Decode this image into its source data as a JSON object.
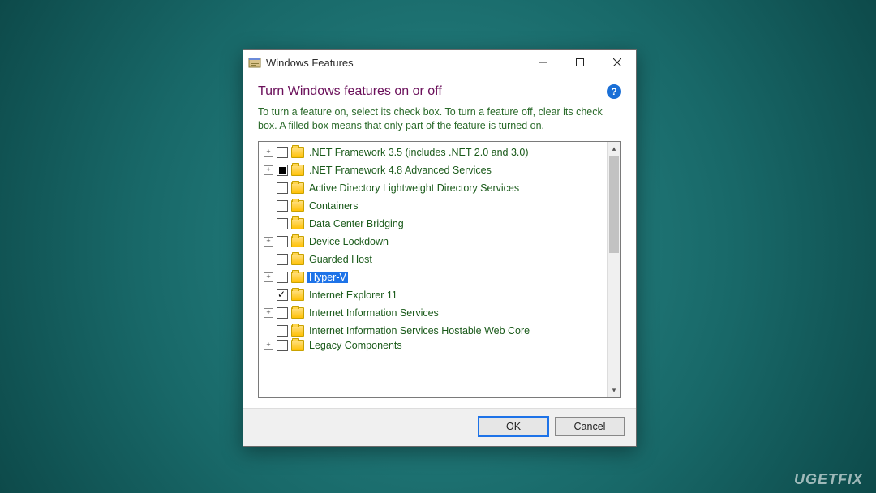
{
  "watermark": "UGETFIX",
  "dialog": {
    "title": "Windows Features",
    "heading": "Turn Windows features on or off",
    "instructions": "To turn a feature on, select its check box. To turn a feature off, clear its check box. A filled box means that only part of the feature is turned on.",
    "help_tooltip": "?",
    "buttons": {
      "ok": "OK",
      "cancel": "Cancel"
    }
  },
  "features": [
    {
      "label": ".NET Framework 3.5 (includes .NET 2.0 and 3.0)",
      "expandable": true,
      "state": "unchecked",
      "selected": false
    },
    {
      "label": ".NET Framework 4.8 Advanced Services",
      "expandable": true,
      "state": "filled",
      "selected": false
    },
    {
      "label": "Active Directory Lightweight Directory Services",
      "expandable": false,
      "state": "unchecked",
      "selected": false
    },
    {
      "label": "Containers",
      "expandable": false,
      "state": "unchecked",
      "selected": false
    },
    {
      "label": "Data Center Bridging",
      "expandable": false,
      "state": "unchecked",
      "selected": false
    },
    {
      "label": "Device Lockdown",
      "expandable": true,
      "state": "unchecked",
      "selected": false
    },
    {
      "label": "Guarded Host",
      "expandable": false,
      "state": "unchecked",
      "selected": false
    },
    {
      "label": "Hyper-V",
      "expandable": true,
      "state": "unchecked",
      "selected": true
    },
    {
      "label": "Internet Explorer 11",
      "expandable": false,
      "state": "checked",
      "selected": false
    },
    {
      "label": "Internet Information Services",
      "expandable": true,
      "state": "unchecked",
      "selected": false
    },
    {
      "label": "Internet Information Services Hostable Web Core",
      "expandable": false,
      "state": "unchecked",
      "selected": false
    },
    {
      "label": "Legacy Components",
      "expandable": true,
      "state": "unchecked",
      "selected": false,
      "cut": true
    }
  ]
}
